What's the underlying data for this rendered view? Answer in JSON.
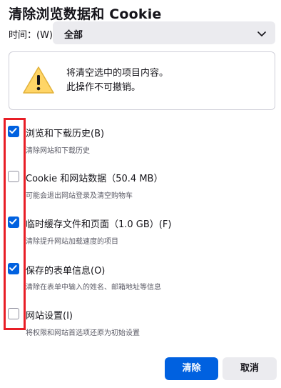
{
  "dialog": {
    "title": "清除浏览数据和 Cookie",
    "time_label": "时间：(W)",
    "time_value": "全部"
  },
  "warning": {
    "icon": "warning-icon",
    "line1": "将清空选中的项目内容。",
    "line2": "此操作不可撤销。"
  },
  "options": [
    {
      "label": "浏览和下载历史(B)",
      "desc": "清除网站和下载历史",
      "checked": true
    },
    {
      "label": "Cookie 和网站数据（50.4 MB）",
      "desc": "可能会退出网站登录及清空购物车",
      "checked": false
    },
    {
      "label": "临时缓存文件和页面（1.0 GB）(F)",
      "desc": "清除提升网站加载速度的项目",
      "checked": true
    },
    {
      "label": "保存的表单信息(O)",
      "desc": "清除在表单中输入的姓名、邮箱地址等信息",
      "checked": true
    },
    {
      "label": "网站设置(I)",
      "desc": "将权限和网站首选项还原为初始设置",
      "checked": false
    }
  ],
  "buttons": {
    "clear": "清除",
    "cancel": "取消"
  },
  "colors": {
    "accent": "#0061e0",
    "highlight": "#e81e26"
  }
}
